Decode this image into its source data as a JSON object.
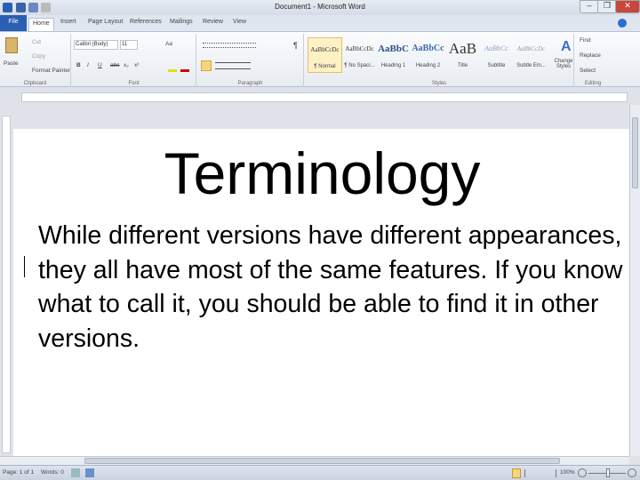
{
  "window": {
    "title": "Document1 - Microsoft Word",
    "minimize": "–",
    "restore": "❐",
    "close": "✕"
  },
  "tabs": [
    "File",
    "Home",
    "Insert",
    "Page Layout",
    "References",
    "Mailings",
    "Review",
    "View"
  ],
  "ribbon": {
    "clipboard": {
      "paste": "Paste",
      "cut": "Cut",
      "copy": "Copy",
      "format_painter": "Format Painter",
      "label": "Clipboard"
    },
    "font": {
      "name": "Calibri (Body)",
      "size": "11",
      "bold": "B",
      "italic": "I",
      "underline": "U",
      "strike": "abc",
      "sub": "x₂",
      "sup": "x²",
      "change_case": "Aa",
      "label": "Font"
    },
    "paragraph": {
      "label": "Paragraph",
      "pilcrow": "¶"
    },
    "styles": {
      "label": "Styles",
      "items": [
        {
          "preview": "AaBbCcDc",
          "name": "¶ Normal"
        },
        {
          "preview": "AaBbCcDc",
          "name": "¶ No Spaci..."
        },
        {
          "preview": "AaBbC",
          "name": "Heading 1"
        },
        {
          "preview": "AaBbCc",
          "name": "Heading 2"
        },
        {
          "preview": "AaB",
          "name": "Title"
        },
        {
          "preview": "AaBbCc",
          "name": "Subtitle"
        },
        {
          "preview": "AaBbCcDc",
          "name": "Subtle Em..."
        }
      ],
      "change_styles": "Change Styles"
    },
    "editing": {
      "find": "Find",
      "replace": "Replace",
      "select": "Select",
      "label": "Editing"
    }
  },
  "document": {
    "heading": "Terminology",
    "body": "While different versions have different appearances, they all have most of the same features. If you know what to call it, you should be able to find it in other versions."
  },
  "status": {
    "page": "Page: 1 of 1",
    "words": "Words: 0",
    "zoom": "100%"
  }
}
